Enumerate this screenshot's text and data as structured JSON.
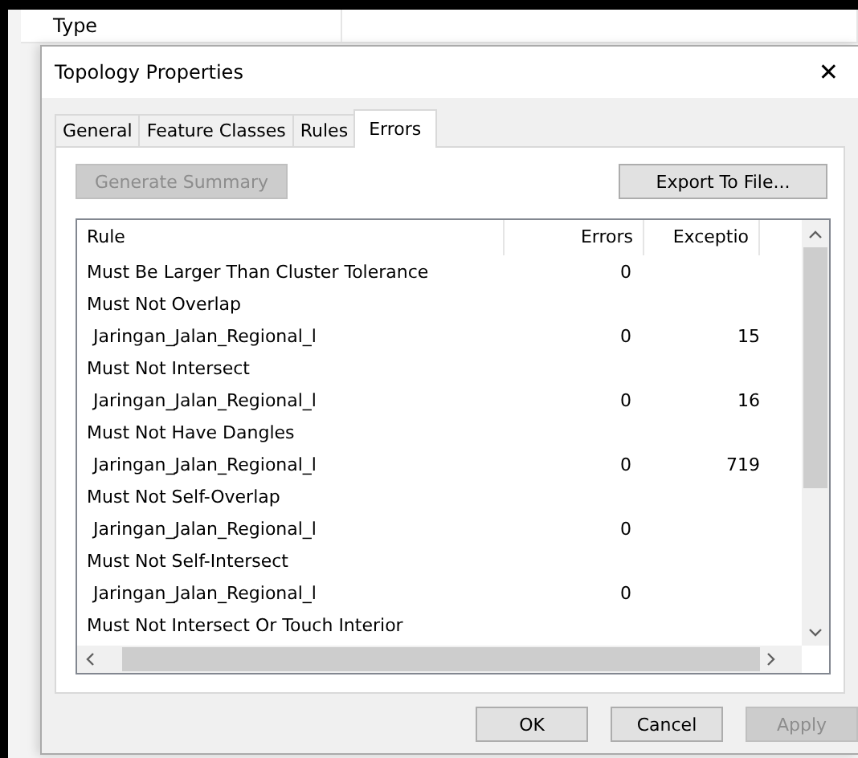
{
  "background_table": {
    "columns": [
      "Type"
    ]
  },
  "window": {
    "title": "Topology Properties",
    "close": "✕"
  },
  "tabs": [
    {
      "label": "General",
      "selected": false
    },
    {
      "label": "Feature Classes",
      "selected": false
    },
    {
      "label": "Rules",
      "selected": false
    },
    {
      "label": "Errors",
      "selected": true
    }
  ],
  "toolbar": {
    "buttons": [
      {
        "label": "Generate Summary",
        "disabled": true
      },
      {
        "label": "Export To File...",
        "disabled": false
      }
    ]
  },
  "table": {
    "columns": [
      "Rule",
      "Errors",
      "Exceptio"
    ],
    "rows": [
      {
        "kind": "rule",
        "name": "Must Be Larger Than Cluster Tolerance",
        "errors": "0",
        "exceptions": ""
      },
      {
        "kind": "rule",
        "name": "Must Not Overlap",
        "errors": "",
        "exceptions": ""
      },
      {
        "kind": "layer",
        "name": "Jaringan_Jalan_Regional_l",
        "errors": "0",
        "exceptions": "15"
      },
      {
        "kind": "rule",
        "name": "Must Not Intersect",
        "errors": "",
        "exceptions": ""
      },
      {
        "kind": "layer",
        "name": "Jaringan_Jalan_Regional_l",
        "errors": "0",
        "exceptions": "16"
      },
      {
        "kind": "rule",
        "name": "Must Not Have Dangles",
        "errors": "",
        "exceptions": ""
      },
      {
        "kind": "layer",
        "name": "Jaringan_Jalan_Regional_l",
        "errors": "0",
        "exceptions": "719"
      },
      {
        "kind": "rule",
        "name": "Must Not Self-Overlap",
        "errors": "",
        "exceptions": ""
      },
      {
        "kind": "layer",
        "name": "Jaringan_Jalan_Regional_l",
        "errors": "0",
        "exceptions": ""
      },
      {
        "kind": "rule",
        "name": "Must Not Self-Intersect",
        "errors": "",
        "exceptions": ""
      },
      {
        "kind": "layer",
        "name": "Jaringan_Jalan_Regional_l",
        "errors": "0",
        "exceptions": ""
      },
      {
        "kind": "rule",
        "name": "Must Not Intersect Or Touch Interior",
        "errors": "",
        "exceptions": ""
      }
    ]
  },
  "buttons": [
    {
      "label": "OK",
      "disabled": false
    },
    {
      "label": "Cancel",
      "disabled": false
    },
    {
      "label": "Apply",
      "disabled": true
    }
  ]
}
